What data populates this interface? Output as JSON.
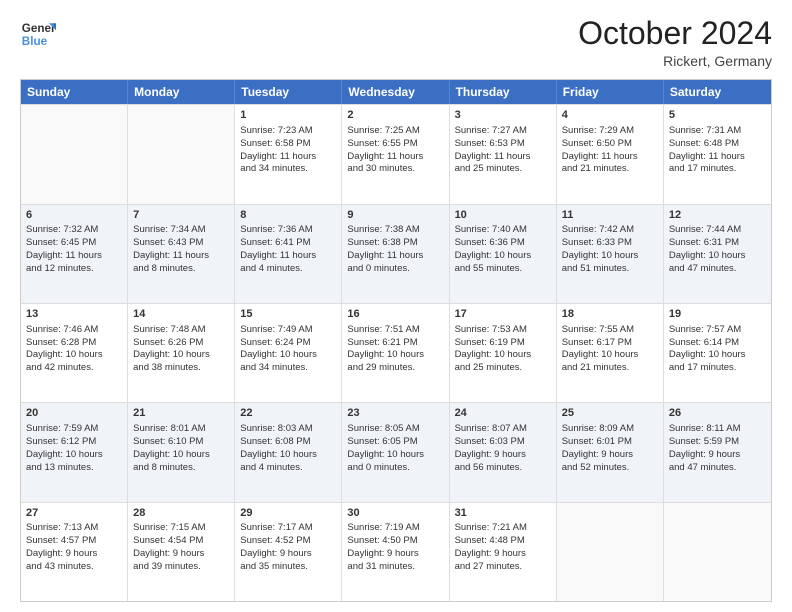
{
  "header": {
    "logo_line1": "General",
    "logo_line2": "Blue",
    "month": "October 2024",
    "location": "Rickert, Germany"
  },
  "days_of_week": [
    "Sunday",
    "Monday",
    "Tuesday",
    "Wednesday",
    "Thursday",
    "Friday",
    "Saturday"
  ],
  "weeks": [
    [
      {
        "day": "",
        "info": ""
      },
      {
        "day": "",
        "info": ""
      },
      {
        "day": "1",
        "info": "Sunrise: 7:23 AM\nSunset: 6:58 PM\nDaylight: 11 hours\nand 34 minutes."
      },
      {
        "day": "2",
        "info": "Sunrise: 7:25 AM\nSunset: 6:55 PM\nDaylight: 11 hours\nand 30 minutes."
      },
      {
        "day": "3",
        "info": "Sunrise: 7:27 AM\nSunset: 6:53 PM\nDaylight: 11 hours\nand 25 minutes."
      },
      {
        "day": "4",
        "info": "Sunrise: 7:29 AM\nSunset: 6:50 PM\nDaylight: 11 hours\nand 21 minutes."
      },
      {
        "day": "5",
        "info": "Sunrise: 7:31 AM\nSunset: 6:48 PM\nDaylight: 11 hours\nand 17 minutes."
      }
    ],
    [
      {
        "day": "6",
        "info": "Sunrise: 7:32 AM\nSunset: 6:45 PM\nDaylight: 11 hours\nand 12 minutes."
      },
      {
        "day": "7",
        "info": "Sunrise: 7:34 AM\nSunset: 6:43 PM\nDaylight: 11 hours\nand 8 minutes."
      },
      {
        "day": "8",
        "info": "Sunrise: 7:36 AM\nSunset: 6:41 PM\nDaylight: 11 hours\nand 4 minutes."
      },
      {
        "day": "9",
        "info": "Sunrise: 7:38 AM\nSunset: 6:38 PM\nDaylight: 11 hours\nand 0 minutes."
      },
      {
        "day": "10",
        "info": "Sunrise: 7:40 AM\nSunset: 6:36 PM\nDaylight: 10 hours\nand 55 minutes."
      },
      {
        "day": "11",
        "info": "Sunrise: 7:42 AM\nSunset: 6:33 PM\nDaylight: 10 hours\nand 51 minutes."
      },
      {
        "day": "12",
        "info": "Sunrise: 7:44 AM\nSunset: 6:31 PM\nDaylight: 10 hours\nand 47 minutes."
      }
    ],
    [
      {
        "day": "13",
        "info": "Sunrise: 7:46 AM\nSunset: 6:28 PM\nDaylight: 10 hours\nand 42 minutes."
      },
      {
        "day": "14",
        "info": "Sunrise: 7:48 AM\nSunset: 6:26 PM\nDaylight: 10 hours\nand 38 minutes."
      },
      {
        "day": "15",
        "info": "Sunrise: 7:49 AM\nSunset: 6:24 PM\nDaylight: 10 hours\nand 34 minutes."
      },
      {
        "day": "16",
        "info": "Sunrise: 7:51 AM\nSunset: 6:21 PM\nDaylight: 10 hours\nand 29 minutes."
      },
      {
        "day": "17",
        "info": "Sunrise: 7:53 AM\nSunset: 6:19 PM\nDaylight: 10 hours\nand 25 minutes."
      },
      {
        "day": "18",
        "info": "Sunrise: 7:55 AM\nSunset: 6:17 PM\nDaylight: 10 hours\nand 21 minutes."
      },
      {
        "day": "19",
        "info": "Sunrise: 7:57 AM\nSunset: 6:14 PM\nDaylight: 10 hours\nand 17 minutes."
      }
    ],
    [
      {
        "day": "20",
        "info": "Sunrise: 7:59 AM\nSunset: 6:12 PM\nDaylight: 10 hours\nand 13 minutes."
      },
      {
        "day": "21",
        "info": "Sunrise: 8:01 AM\nSunset: 6:10 PM\nDaylight: 10 hours\nand 8 minutes."
      },
      {
        "day": "22",
        "info": "Sunrise: 8:03 AM\nSunset: 6:08 PM\nDaylight: 10 hours\nand 4 minutes."
      },
      {
        "day": "23",
        "info": "Sunrise: 8:05 AM\nSunset: 6:05 PM\nDaylight: 10 hours\nand 0 minutes."
      },
      {
        "day": "24",
        "info": "Sunrise: 8:07 AM\nSunset: 6:03 PM\nDaylight: 9 hours\nand 56 minutes."
      },
      {
        "day": "25",
        "info": "Sunrise: 8:09 AM\nSunset: 6:01 PM\nDaylight: 9 hours\nand 52 minutes."
      },
      {
        "day": "26",
        "info": "Sunrise: 8:11 AM\nSunset: 5:59 PM\nDaylight: 9 hours\nand 47 minutes."
      }
    ],
    [
      {
        "day": "27",
        "info": "Sunrise: 7:13 AM\nSunset: 4:57 PM\nDaylight: 9 hours\nand 43 minutes."
      },
      {
        "day": "28",
        "info": "Sunrise: 7:15 AM\nSunset: 4:54 PM\nDaylight: 9 hours\nand 39 minutes."
      },
      {
        "day": "29",
        "info": "Sunrise: 7:17 AM\nSunset: 4:52 PM\nDaylight: 9 hours\nand 35 minutes."
      },
      {
        "day": "30",
        "info": "Sunrise: 7:19 AM\nSunset: 4:50 PM\nDaylight: 9 hours\nand 31 minutes."
      },
      {
        "day": "31",
        "info": "Sunrise: 7:21 AM\nSunset: 4:48 PM\nDaylight: 9 hours\nand 27 minutes."
      },
      {
        "day": "",
        "info": ""
      },
      {
        "day": "",
        "info": ""
      }
    ]
  ]
}
